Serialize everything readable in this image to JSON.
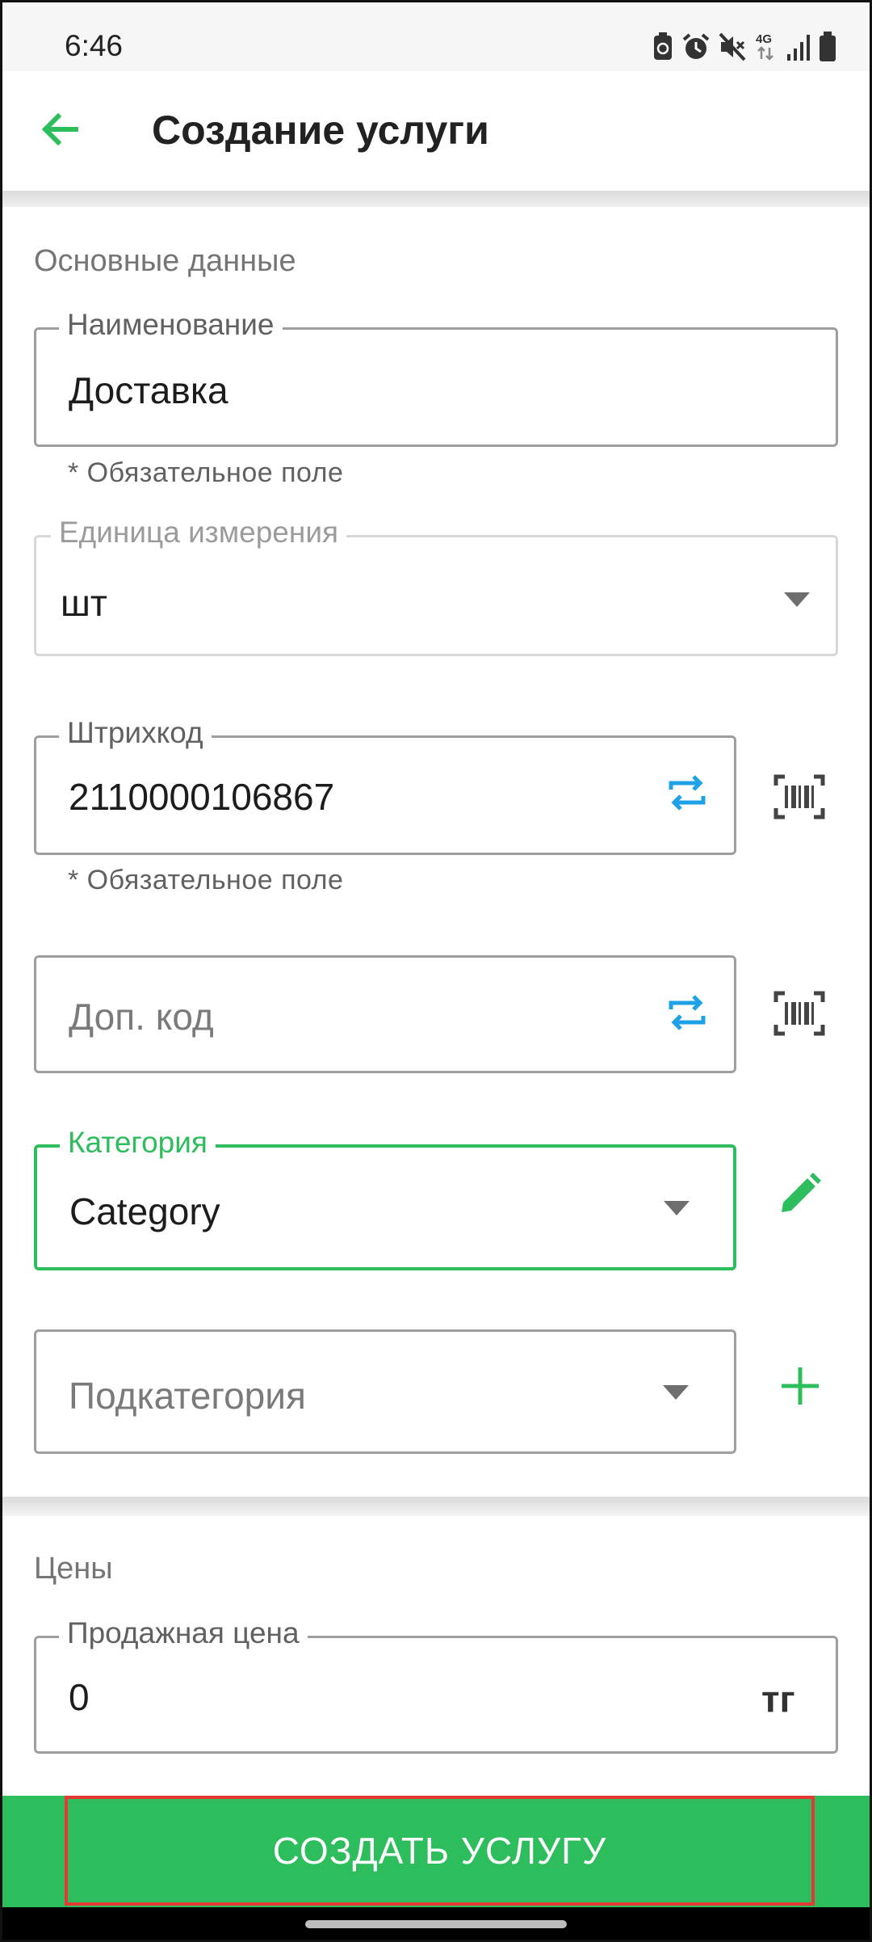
{
  "status_bar": {
    "time": "6:46",
    "icons": [
      "battery-saver-icon",
      "alarm-icon",
      "mute-icon",
      "network-4g-icon",
      "signal-icon",
      "battery-icon"
    ],
    "network_label": "4G"
  },
  "app_bar": {
    "title": "Создание услуги",
    "back_icon": "arrow-back-icon"
  },
  "sections": {
    "basic": {
      "label": "Основные данные",
      "name_field": {
        "label": "Наименование",
        "value": "Доставка",
        "helper": "* Обязательное поле"
      },
      "unit_field": {
        "label": "Единица измерения",
        "value": "шт"
      },
      "barcode_field": {
        "label": "Штрихкод",
        "value": "2110000106867",
        "helper": "* Обязательное поле"
      },
      "extra_code_field": {
        "placeholder": "Доп. код"
      },
      "category_field": {
        "label": "Категория",
        "value": "Category"
      },
      "subcategory_field": {
        "placeholder": "Подкатегория"
      }
    },
    "prices": {
      "label": "Цены",
      "sale_price_field": {
        "label": "Продажная цена",
        "value": "0",
        "suffix": "тг"
      }
    }
  },
  "actions": {
    "create_label": "СОЗДАТЬ УСЛУГУ"
  },
  "colors": {
    "accent_green": "#2ebd5c",
    "accent_blue": "#1ea1e6",
    "highlight_red": "#e53935"
  }
}
